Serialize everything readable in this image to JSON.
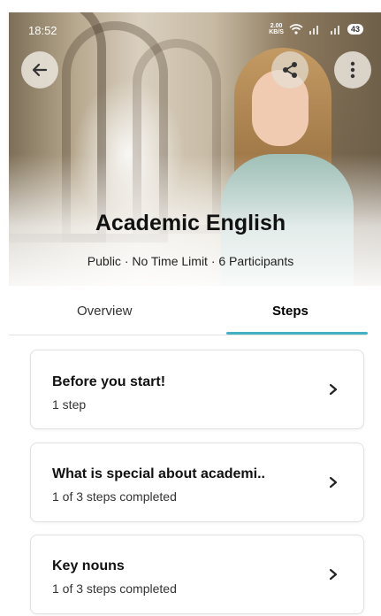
{
  "status_bar": {
    "time": "18:52",
    "net_speed_value": "2.00",
    "net_speed_unit": "KB/S",
    "battery": "43"
  },
  "course": {
    "title": "Academic English",
    "meta": "Public · No Time Limit · 6 Participants"
  },
  "tabs": [
    {
      "label": "Overview",
      "active": false
    },
    {
      "label": "Steps",
      "active": true
    }
  ],
  "steps": [
    {
      "title": "Before you start!",
      "subtitle": "1 step"
    },
    {
      "title": "What is special about academi..",
      "subtitle": "1 of 3 steps completed"
    },
    {
      "title": "Key nouns",
      "subtitle": "1 of 3 steps completed"
    }
  ],
  "icons": {
    "back": "arrow-left-icon",
    "share": "share-icon",
    "more": "more-vertical-icon",
    "chevron": "chevron-right-icon"
  },
  "colors": {
    "tab_underline": "#43b1c4",
    "card_border": "#e1e1e1"
  }
}
